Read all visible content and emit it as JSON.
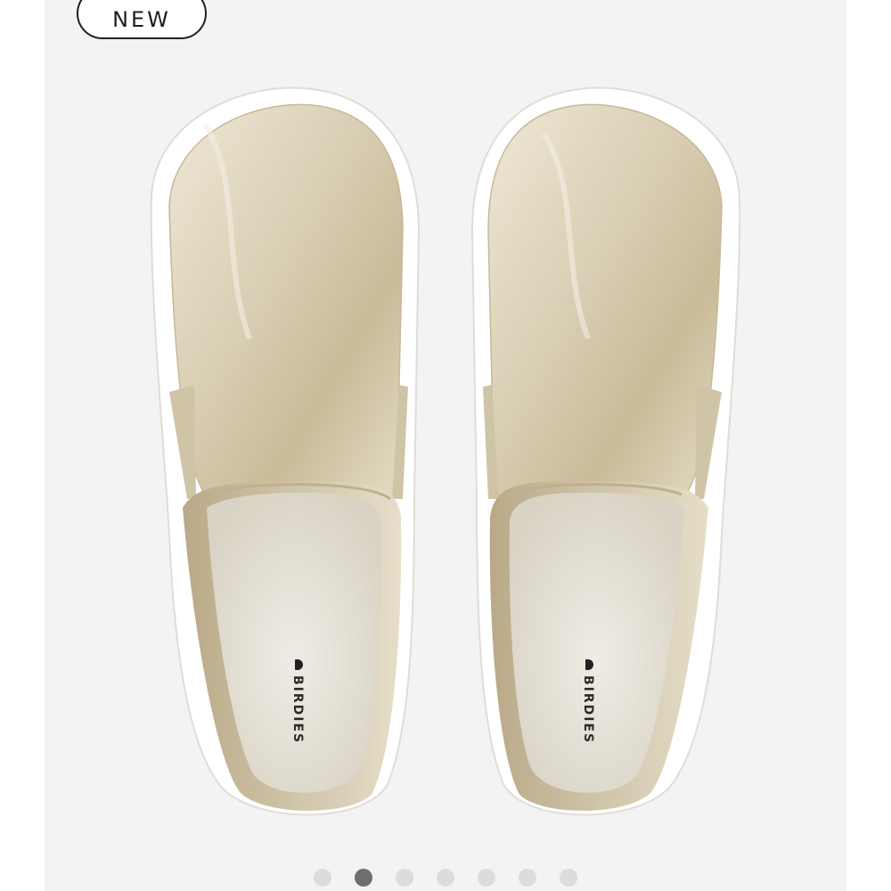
{
  "badge": {
    "label": "NEW"
  },
  "product": {
    "brand_mark": "BIRDIES",
    "colors": {
      "leather": "#d9d0bb",
      "sole": "#ffffff",
      "insole": "#e6e2d8"
    }
  },
  "carousel": {
    "count": 7,
    "active_index": 1,
    "dot_color": "#dcdcdc",
    "active_color": "#6e6e6e"
  }
}
